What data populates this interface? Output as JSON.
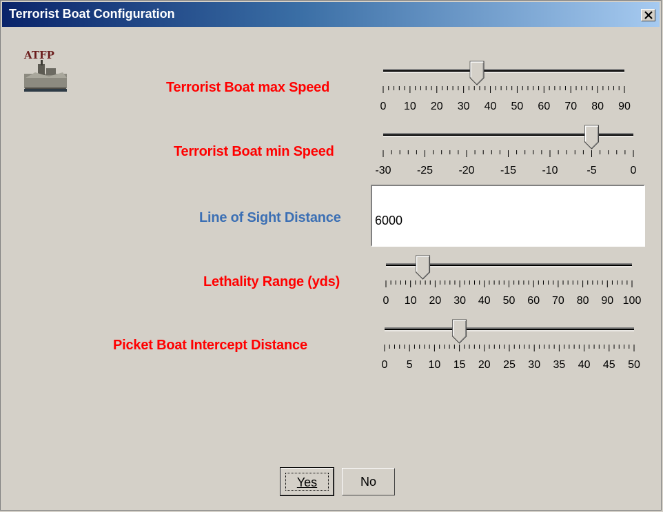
{
  "window": {
    "title": "Terrorist Boat Configuration",
    "close_icon": "close-x-icon"
  },
  "logo": {
    "text": "ATFP",
    "icon": "warship-icon"
  },
  "fields": {
    "max_speed": {
      "label": "Terrorist Boat max Speed",
      "value": 35,
      "min": 0,
      "max": 90,
      "tick_labels": [
        "0",
        "10",
        "20",
        "30",
        "40",
        "50",
        "60",
        "70",
        "80",
        "90"
      ],
      "label_color": "#ff0000"
    },
    "min_speed": {
      "label": "Terrorist Boat min Speed",
      "value": -5,
      "min": -30,
      "max": 0,
      "tick_labels": [
        "-30",
        "-25",
        "-20",
        "-15",
        "-10",
        "-5",
        "0"
      ],
      "label_color": "#ff0000"
    },
    "line_of_sight": {
      "label": "Line of Sight Distance",
      "value": "6000",
      "label_color": "#3b6fb4"
    },
    "lethality": {
      "label": "Lethality Range (yds)",
      "value": 15,
      "min": 0,
      "max": 100,
      "tick_labels": [
        "0",
        "10",
        "20",
        "30",
        "40",
        "50",
        "60",
        "70",
        "80",
        "90",
        "100"
      ],
      "label_color": "#ff0000"
    },
    "intercept": {
      "label": "Picket Boat Intercept Distance",
      "value": 15,
      "min": 0,
      "max": 50,
      "tick_labels": [
        "0",
        "5",
        "10",
        "15",
        "20",
        "25",
        "30",
        "35",
        "40",
        "45",
        "50"
      ],
      "label_color": "#ff0000"
    }
  },
  "buttons": {
    "yes": "Yes",
    "no": "No"
  }
}
